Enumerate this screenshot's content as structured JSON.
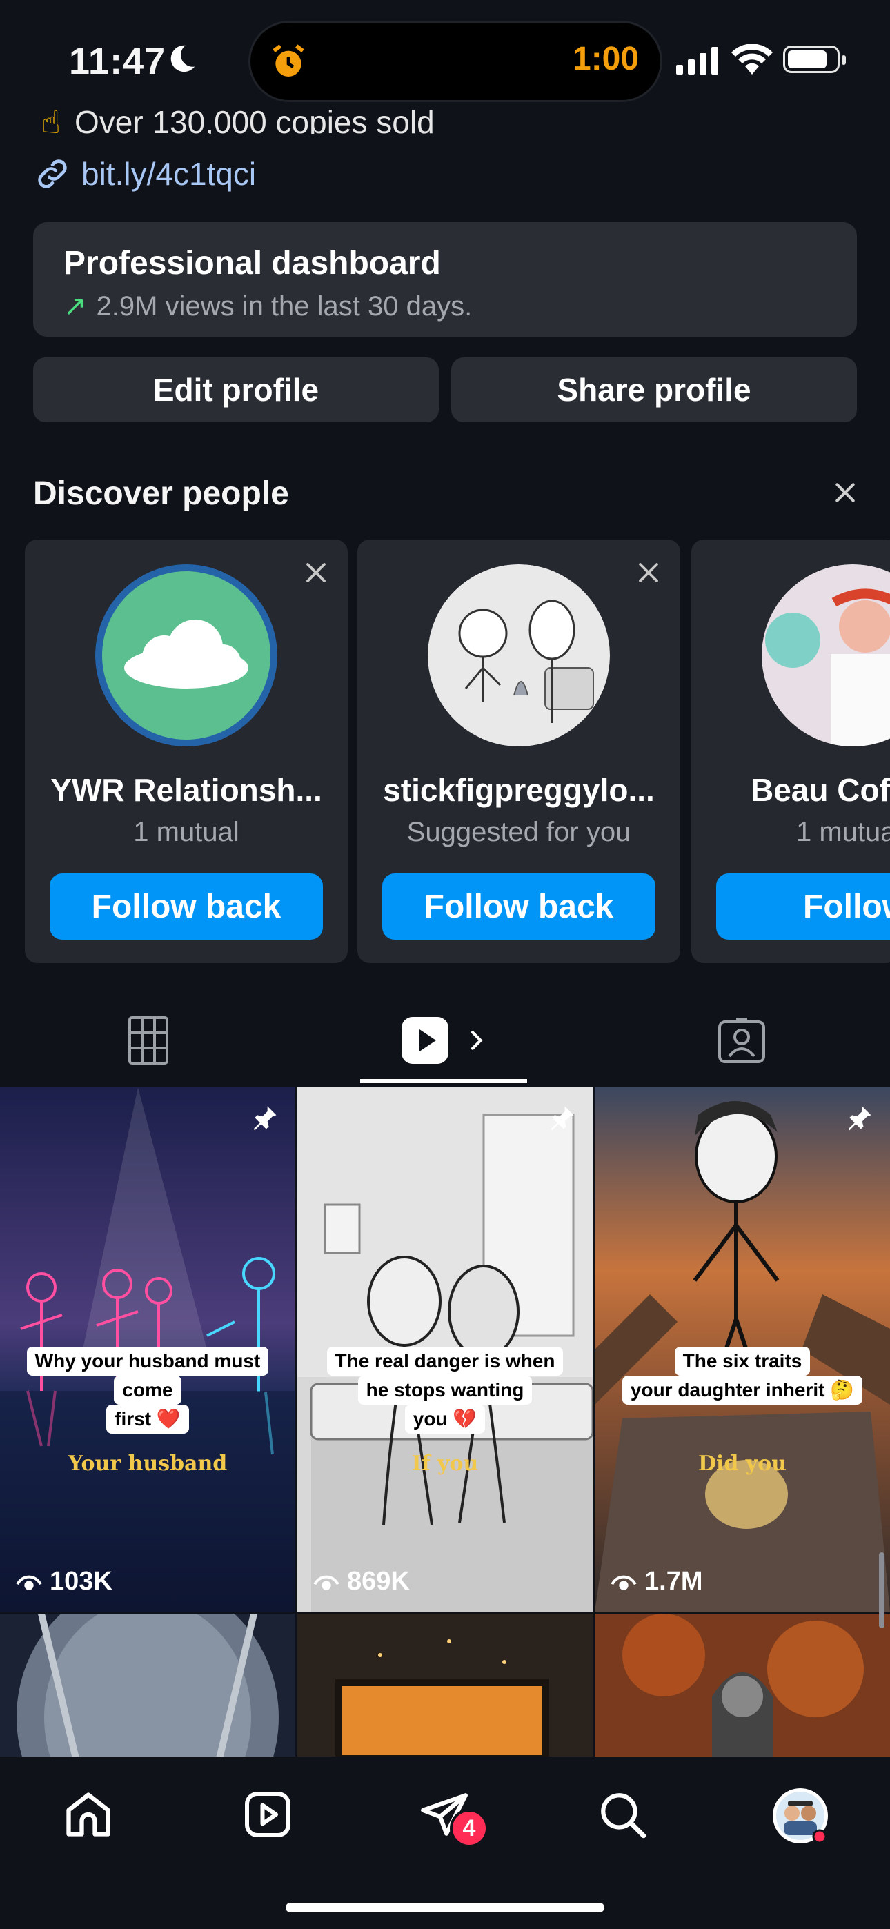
{
  "status_bar": {
    "time": "11:47",
    "timer": "1:00",
    "alarm_icon": "alarm-clock-icon",
    "moon_icon": "moon-icon",
    "accent_color": "#f59e0b"
  },
  "bio": {
    "line": "Over 130,000 copies sold",
    "link": "bit.ly/4c1tqci"
  },
  "dashboard": {
    "title": "Professional dashboard",
    "subtitle": "2.9M views in the last 30 days."
  },
  "buttons": {
    "edit_profile": "Edit profile",
    "share_profile": "Share profile"
  },
  "discover": {
    "title": "Discover people",
    "cards": [
      {
        "name": "YWR Relationsh...",
        "sub": "1 mutual",
        "button": "Follow back"
      },
      {
        "name": "stickfigpreggylo...",
        "sub": "Suggested for you",
        "button": "Follow back"
      },
      {
        "name": "Beau Cof",
        "sub": "1 mutua",
        "button": "Follow"
      }
    ]
  },
  "tabs": [
    "grid",
    "reels",
    "tagged"
  ],
  "grid": {
    "tiles": [
      {
        "caption": [
          "Why your husband must",
          "come",
          "first ❤️"
        ],
        "overlay": "Your husband",
        "views": "103K"
      },
      {
        "caption": [
          "The real danger is when",
          "he stops wanting",
          "you 💔"
        ],
        "overlay": "If you",
        "views": "869K"
      },
      {
        "caption": [
          "The six traits",
          "your daughter inherit 🤔"
        ],
        "overlay": "Did you",
        "views": "1.7M"
      }
    ]
  },
  "nav": {
    "badge": "4",
    "brand_color": "#0095f6"
  }
}
